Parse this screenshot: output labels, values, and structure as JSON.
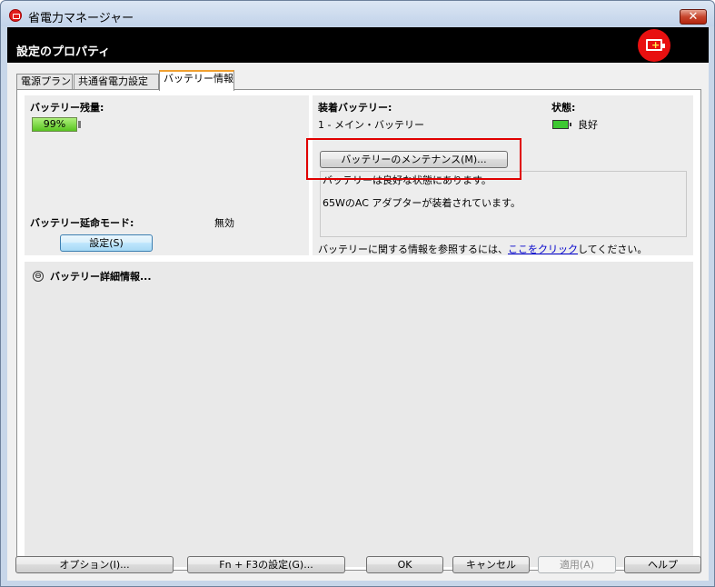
{
  "window": {
    "title": "省電力マネージャー",
    "close_label": "✕"
  },
  "header": {
    "title": "設定のプロパティ",
    "icon_plus": "+"
  },
  "tabs": [
    {
      "label": "電源プラン"
    },
    {
      "label": "共通省電力設定"
    },
    {
      "label": "バッテリー情報"
    }
  ],
  "battery": {
    "remaining_label": "バッテリー残量:",
    "remaining_value": "99%",
    "remaining_fraction": 0.99,
    "extend_mode_label": "バッテリー延命モード:",
    "extend_mode_value": "無効",
    "settings_button": "設定(S)"
  },
  "installed": {
    "label": "装着バッテリー:",
    "value": "1 - メイン・バッテリー",
    "status_label": "状態:",
    "status_value": "良好",
    "maintenance_button": "バッテリーのメンテナンス(M)...",
    "message_1": "バッテリーは良好な状態にあります。",
    "message_2": "65WのAC アダプターが装着されています。",
    "info_prefix": "バッテリーに関する情報を参照するには、",
    "info_link": "ここをクリック",
    "info_suffix": "してください。"
  },
  "details": {
    "expander_glyph": "⊖",
    "label": "バッテリー詳細情報..."
  },
  "footer": {
    "options": "オプション(I)...",
    "fn_f3": "Fn + F3の設定(G)...",
    "ok": "OK",
    "cancel": "キャンセル",
    "apply": "適用(A)",
    "help": "ヘルプ"
  },
  "colors": {
    "header_bg": "#000000",
    "tab_accent": "#f0a030",
    "battery_fill": "#58c420",
    "highlight": "#e00000"
  }
}
